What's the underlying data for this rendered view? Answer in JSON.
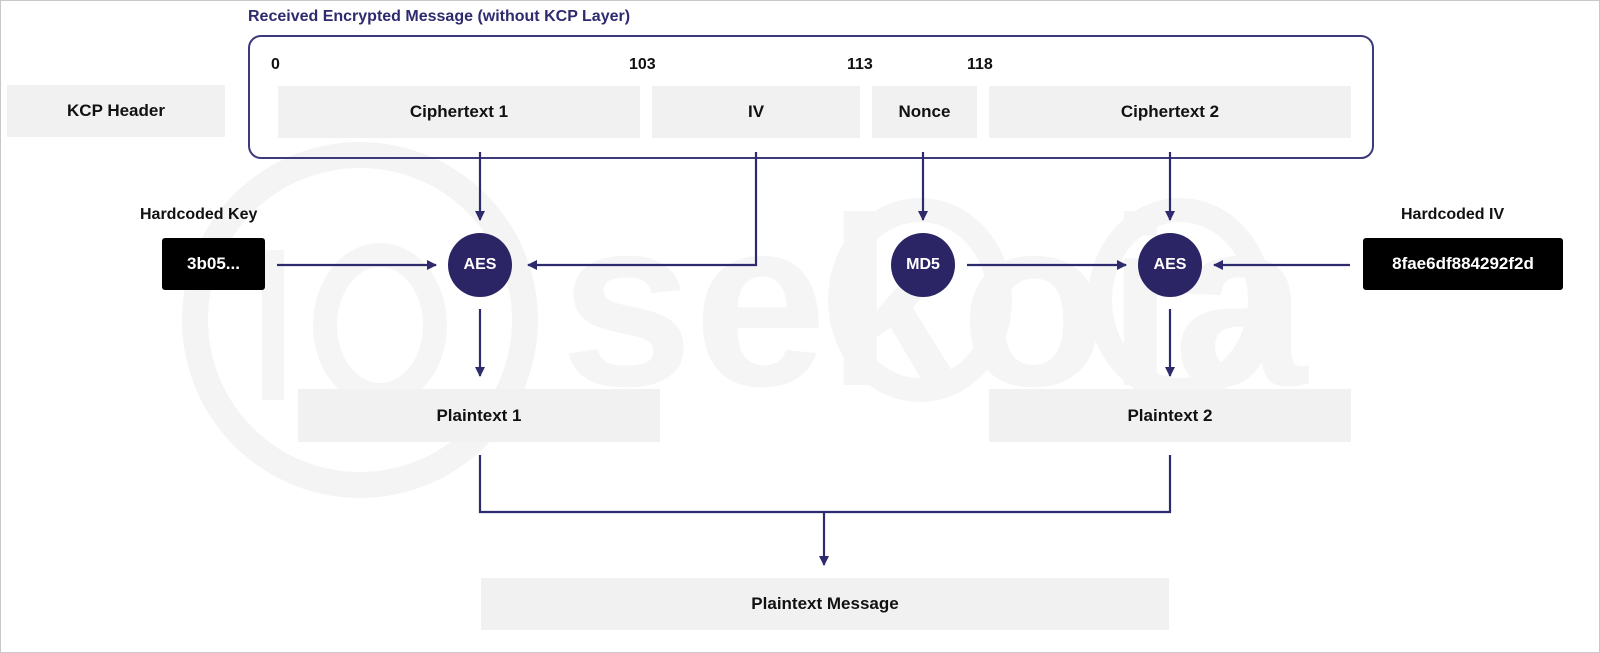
{
  "diagram": {
    "title": "Received Encrypted Message (without KCP Layer)",
    "watermark": "sekoia",
    "kcp_header": "KCP Header",
    "offsets": [
      "0",
      "103",
      "113",
      "118"
    ],
    "segments": [
      {
        "label": "Ciphertext 1"
      },
      {
        "label": "IV"
      },
      {
        "label": "Nonce"
      },
      {
        "label": "Ciphertext 2"
      }
    ],
    "hardcoded_key": {
      "label": "Hardcoded Key",
      "value": "3b05..."
    },
    "hardcoded_iv": {
      "label": "Hardcoded IV",
      "value": "8fae6df884292f2d"
    },
    "nodes": {
      "aes1": "AES",
      "md5": "MD5",
      "aes2": "AES"
    },
    "plaintext1": "Plaintext 1",
    "plaintext2": "Plaintext 2",
    "plaintext_message": "Plaintext Message",
    "colors": {
      "accent": "#2b2566",
      "line": "#2e2a6e",
      "box_fill": "#f1f1f1",
      "key_fill": "#000000"
    }
  }
}
